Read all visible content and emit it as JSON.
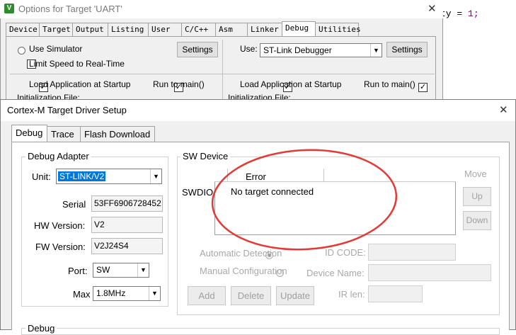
{
  "background_code": {
    "text": "ty = ",
    "number": "1;"
  },
  "options_window": {
    "title": "Options for Target 'UART'",
    "tabs": [
      "Device",
      "Target",
      "Output",
      "Listing",
      "User",
      "C/C++",
      "Asm",
      "Linker",
      "Debug",
      "Utilities"
    ],
    "selected_tab": "Debug",
    "left": {
      "use_simulator": "Use Simulator",
      "settings": "Settings",
      "limit_speed": "Limit Speed to Real-Time",
      "load_app": "Load Application at Startup",
      "run_to_main": "Run to main()",
      "init_file": "Initialization File:"
    },
    "right": {
      "use": "Use:",
      "debugger": "ST-Link Debugger",
      "settings": "Settings",
      "load_app": "Load Application at Startup",
      "run_to_main": "Run to main()",
      "init_file": "Initialization File:"
    }
  },
  "cortex_dialog": {
    "title": "Cortex-M Target Driver Setup",
    "tabs": [
      "Debug",
      "Trace",
      "Flash Download"
    ],
    "selected_tab": "Debug",
    "debug_adapter": {
      "label": "Debug Adapter",
      "unit_label": "Unit:",
      "unit_value": "ST-LINK/V2",
      "serial_label": "Serial",
      "serial_value": "53FF6906728452",
      "hw_label": "HW Version:",
      "hw_value": "V2",
      "fw_label": "FW Version:",
      "fw_value": "V2J24S4",
      "port_label": "Port:",
      "port_value": "SW",
      "max_label": "Max",
      "max_value": "1.8MHz"
    },
    "sw_device": {
      "label": "SW Device",
      "column_header": "Error",
      "row_label": "SWDIO",
      "row_value": "No target connected",
      "move": "Move",
      "up": "Up",
      "down": "Down",
      "auto_detect": "Automatic Detection",
      "manual_config": "Manual Configuration",
      "id_code": "ID CODE:",
      "device_name": "Device Name:",
      "ir_len": "IR len:",
      "add": "Add",
      "delete": "Delete",
      "update": "Update"
    },
    "debug_group_label": "Debug"
  },
  "annotation_color": "#e53935"
}
